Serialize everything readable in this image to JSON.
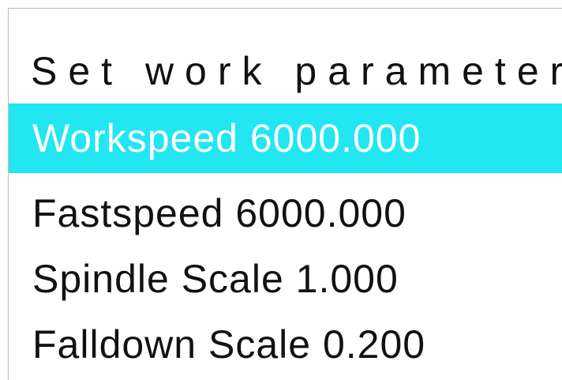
{
  "screen": {
    "title": "Set work parameter",
    "selected_color": "#22e6f2",
    "items": [
      {
        "label": "Workspeed 6000.000",
        "selected": true
      },
      {
        "label": "Fastspeed 6000.000",
        "selected": false
      },
      {
        "label": "Spindle Scale 1.000",
        "selected": false
      },
      {
        "label": "Falldown Scale 0.200",
        "selected": false
      }
    ]
  }
}
